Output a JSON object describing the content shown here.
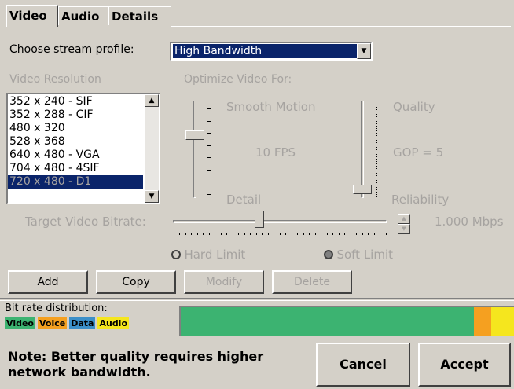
{
  "tabs": [
    {
      "label": "Video",
      "active": true
    },
    {
      "label": "Audio",
      "active": false
    },
    {
      "label": "Details",
      "active": false
    }
  ],
  "profile": {
    "label": "Choose stream profile:",
    "value": "High Bandwidth"
  },
  "resolution": {
    "label": "Video Resolution",
    "items": [
      "352 x 240 - SIF",
      "352 x 288 - CIF",
      "480 x 320",
      "528 x 368",
      "640 x 480 - VGA",
      "704 x 480 - 4SIF",
      "720 x 480 - D1"
    ],
    "selected": "720 x 480 - D1"
  },
  "optimize": {
    "label": "Optimize Video For:",
    "smooth_label": "Smooth Motion",
    "detail_label": "Detail",
    "fps_label": "10 FPS",
    "quality_label": "Quality",
    "reliability_label": "Reliability",
    "gop_label": "GOP = 5"
  },
  "bitrate": {
    "label": "Target Video Bitrate:",
    "value_text": "1.000 Mbps",
    "hard_limit": "Hard Limit",
    "soft_limit": "Soft Limit",
    "selected_limit": "Soft Limit"
  },
  "buttons": {
    "add": "Add",
    "copy": "Copy",
    "modify": "Modify",
    "delete": "Delete",
    "cancel": "Cancel",
    "accept": "Accept"
  },
  "distribution": {
    "label": "Bit rate distribution:",
    "legend": [
      {
        "name": "Video",
        "color": "#3cb371"
      },
      {
        "name": "Voice",
        "color": "#f5a020"
      },
      {
        "name": "Data",
        "color": "#3c8fc8"
      },
      {
        "name": "Audio",
        "color": "#f5e61e"
      }
    ],
    "shares": [
      0.88,
      0.052,
      0.0,
      0.068
    ]
  },
  "note": {
    "line1": "Note: Better quality requires higher",
    "line2": "network bandwidth."
  }
}
